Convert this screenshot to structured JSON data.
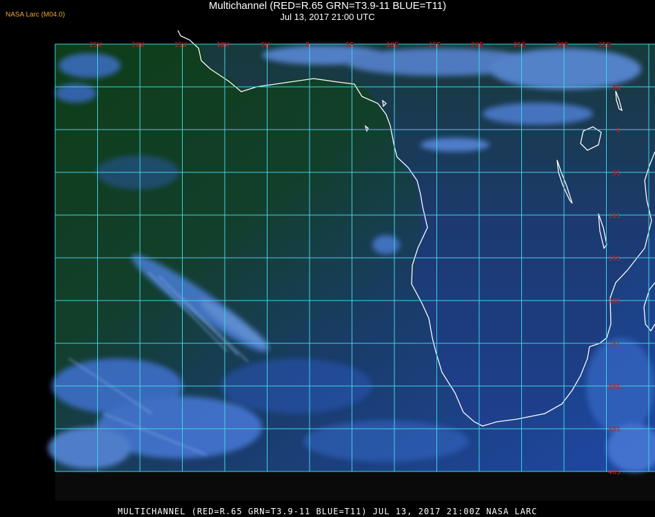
{
  "header": {
    "credit": "NASA Larc (M04.0)",
    "title": "Multichannel (RED=R.65 GRN=T3.9-11 BLUE=T11)",
    "subtitle": "Jul 13, 2017 21:00 UTC"
  },
  "footer": {
    "caption": "MULTICHANNEL (RED=R.65 GRN=T3.9-11 BLUE=T11) JUL 13, 2017 21:00Z   NASA LARC"
  },
  "grid": {
    "line_color": "#3fd6e6",
    "label_color": "#cc2020",
    "longitude_labels": [
      "25W",
      "20W",
      "15W",
      "10W",
      "5W",
      "0",
      "5E",
      "10E",
      "15E",
      "20E",
      "25E",
      "30E",
      "35E"
    ],
    "latitude_labels": [
      "5N",
      "0",
      "5S",
      "10S",
      "15S",
      "20S",
      "25S",
      "30S",
      "35S",
      "40S"
    ]
  },
  "colors": {
    "ocean_green": "#0d3a16",
    "ocean_blue": "#1e3f8a",
    "cloud": "#6a9be8",
    "coastline": "#ffffff"
  }
}
